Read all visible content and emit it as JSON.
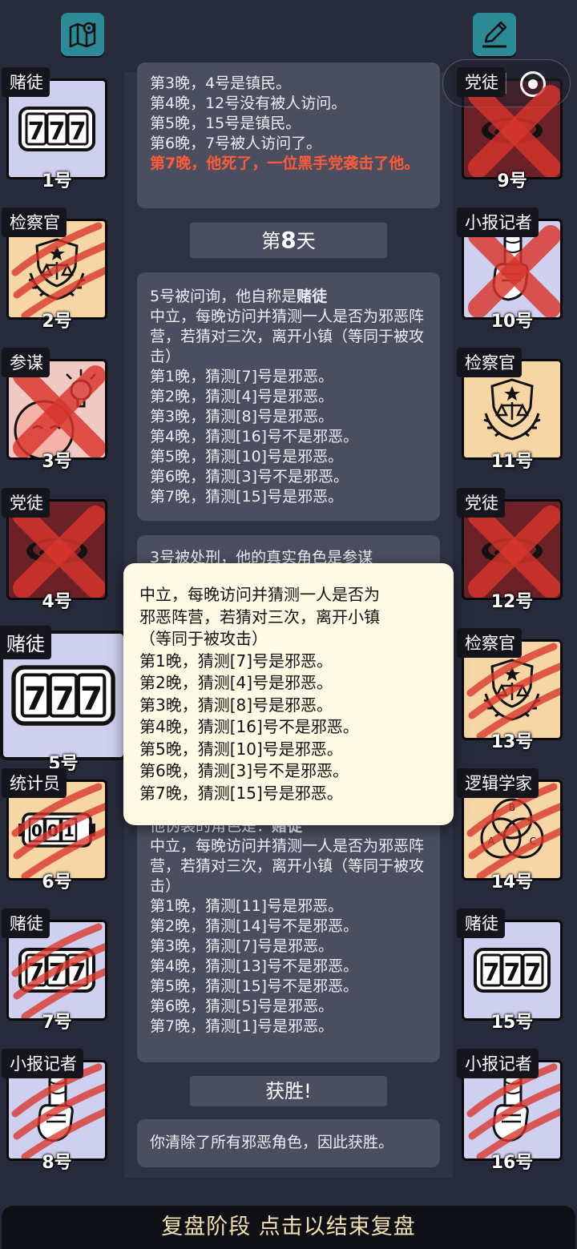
{
  "capsule": {
    "dots": "••",
    "more_label": "more",
    "close_label": "close"
  },
  "left_cards": [
    {
      "role": "赌徒",
      "num": "1号",
      "bg": "blue",
      "icon": "slot-777",
      "state": "alive"
    },
    {
      "role": "检察官",
      "num": "2号",
      "bg": "tan",
      "icon": "justice-emblem",
      "state": "clawed"
    },
    {
      "role": "参谋",
      "num": "3号",
      "bg": "pink",
      "icon": "advisor-face",
      "state": "dead"
    },
    {
      "role": "党徒",
      "num": "4号",
      "bg": "red",
      "icon": "hole",
      "state": "dead"
    },
    {
      "role": "赌徒",
      "num": "5号",
      "bg": "blue",
      "icon": "slot-777",
      "state": "selected"
    },
    {
      "role": "统计员",
      "num": "6号",
      "bg": "tan",
      "icon": "counter",
      "state": "clawed"
    },
    {
      "role": "赌徒",
      "num": "7号",
      "bg": "blue",
      "icon": "slot-777",
      "state": "clawed"
    },
    {
      "role": "小报记者",
      "num": "8号",
      "bg": "blue",
      "icon": "scroll-hand",
      "state": "clawed"
    }
  ],
  "right_cards": [
    {
      "role": "党徒",
      "num": "9号",
      "bg": "red",
      "icon": "hole",
      "state": "dead"
    },
    {
      "role": "小报记者",
      "num": "10号",
      "bg": "blue",
      "icon": "scroll-hand",
      "state": "dead"
    },
    {
      "role": "检察官",
      "num": "11号",
      "bg": "tan",
      "icon": "justice-emblem",
      "state": "alive"
    },
    {
      "role": "党徒",
      "num": "12号",
      "bg": "red",
      "icon": "hole",
      "state": "dead"
    },
    {
      "role": "检察官",
      "num": "13号",
      "bg": "tan",
      "icon": "justice-emblem",
      "state": "clawed"
    },
    {
      "role": "逻辑学家",
      "num": "14号",
      "bg": "tan",
      "icon": "venn-abc",
      "state": "clawed"
    },
    {
      "role": "赌徒",
      "num": "15号",
      "bg": "blue",
      "icon": "slot-777",
      "state": "alive"
    },
    {
      "role": "小报记者",
      "num": "16号",
      "bg": "blue",
      "icon": "scroll-hand",
      "state": "clawed"
    }
  ],
  "log_top": {
    "lines": [
      "第3晚，4号是镇民。",
      "第4晚，12号没有被人访问。",
      "第5晚，15号是镇民。",
      "第6晚，7号被人访问了。"
    ],
    "red_text": "第7晚，他死了，一位黑手党袭击了他。"
  },
  "day8": {
    "prefix": "第",
    "number": "8",
    "suffix": "天"
  },
  "interrogation": {
    "intro": "5号被问询，他自称是",
    "role": "赌徒",
    "desc": "中立，每晚访问并猜测一人是否为邪恶阵营，若猜对三次，离开小镇（等同于被攻击）",
    "nights": [
      "第1晚，猜测[7]号是邪恶。",
      "第2晚，猜测[4]号是邪恶。",
      "第3晚，猜测[8]号是邪恶。",
      "第4晚，猜测[16]号不是邪恶。",
      "第5晚，猜测[10]号是邪恶。",
      "第6晚，猜测[3]号不是邪恶。",
      "第7晚，猜测[15]号是邪恶。"
    ]
  },
  "execution": {
    "partial_title": "3号被处刑，他的真实角色是参谋",
    "fake_intro": "他伪装的角色是：",
    "fake_role": "赌徒",
    "desc": "中立，每晚访问并猜测一人是否为邪恶阵营，若猜对三次，离开小镇（等同于被攻击）",
    "nights": [
      "第1晚，猜测[11]号是邪恶。",
      "第2晚，猜测[14]号不是邪恶。",
      "第3晚，猜测[7]号是邪恶。",
      "第4晚，猜测[13]号不是邪恶。",
      "第5晚，猜测[15]号不是邪恶。",
      "第6晚，猜测[5]号是邪恶。",
      "第7晚，猜测[1]号是邪恶。"
    ]
  },
  "victory": {
    "title": "获胜!",
    "text": "你清除了所有邪恶角色，因此获胜。"
  },
  "tooltip": {
    "lines": [
      "中立，每晚访问并猜测一人是否为",
      "邪恶阵营，若猜对三次，离开小镇",
      "（等同于被攻击）",
      "第1晚，猜测[7]号是邪恶。",
      "第2晚，猜测[4]号是邪恶。",
      "第3晚，猜测[8]号是邪恶。",
      "第4晚，猜测[16]号不是邪恶。",
      "第5晚，猜测[10]号是邪恶。",
      "第6晚，猜测[3]号不是邪恶。",
      "第7晚，猜测[15]号是邪恶。"
    ]
  },
  "bottom_bar": {
    "label": "复盘阶段 点击以结束复盘"
  },
  "colors": {
    "accent_teal": "#2b8a96",
    "warning_red": "#ff5b3a",
    "tooltip_bg": "#fdfbe6",
    "bottom_text": "#f3e1b0"
  }
}
